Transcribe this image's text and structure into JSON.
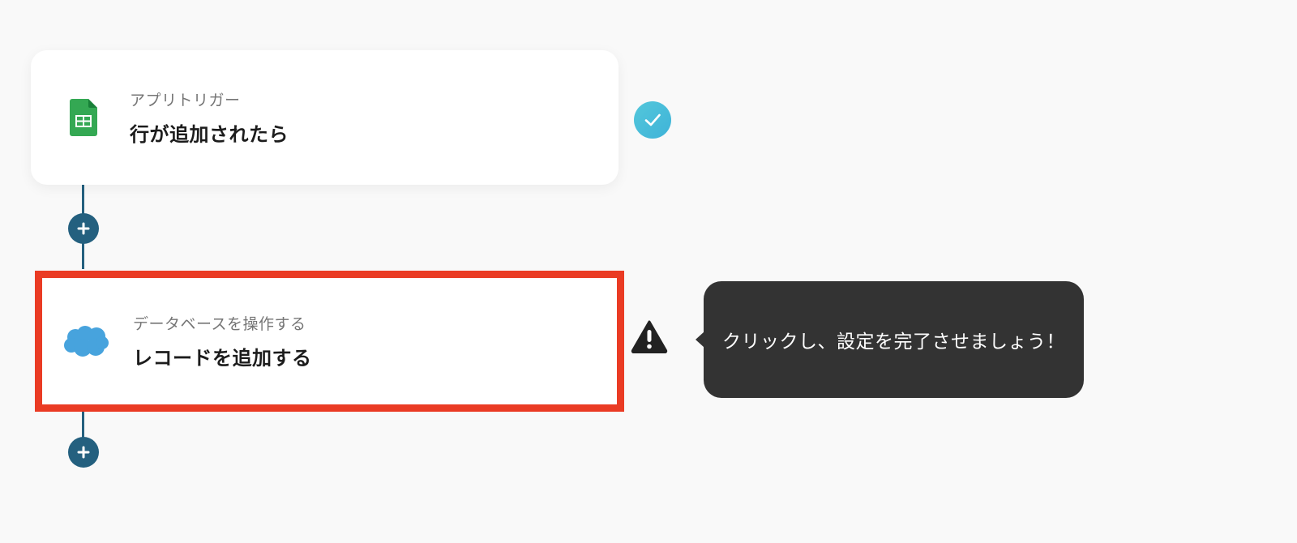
{
  "flow": {
    "steps": [
      {
        "type_label": "アプリトリガー",
        "title": "行が追加されたら",
        "app_icon": "google-sheets-icon",
        "status": "completed"
      },
      {
        "type_label": "データベースを操作する",
        "title": "レコードを追加する",
        "app_icon": "salesforce-icon",
        "status": "incomplete"
      }
    ]
  },
  "tooltip": {
    "text": "クリックし、設定を完了させましょう！"
  },
  "colors": {
    "connector": "#24607f",
    "highlight_border": "#ea3b24",
    "check_badge": "#4cc0da",
    "tooltip_bg": "#333333",
    "sheets_green": "#34a853",
    "salesforce_blue": "#47a3dd"
  }
}
